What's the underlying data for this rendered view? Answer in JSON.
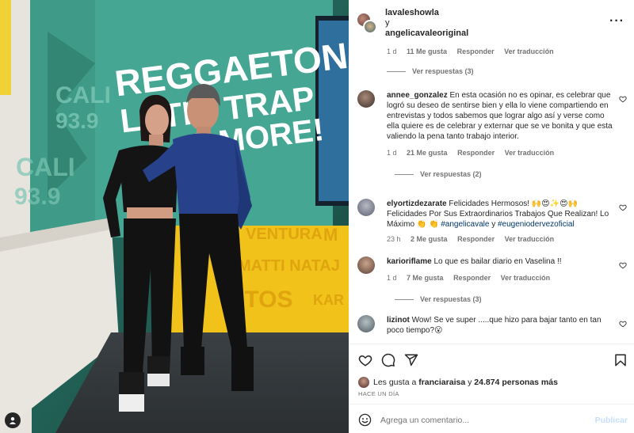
{
  "post": {
    "author": "lavaleshowla",
    "connector": "y",
    "coauthor": "angelicavaleoriginal",
    "more_icon": "more-dots-icon"
  },
  "photo": {
    "sign_main": "REGGAETON,",
    "sign_line2": "LATIN TRAP",
    "sign_line3": "& MORE!",
    "station_a": "CALI",
    "station_b": "93.9",
    "station_c": "CALI",
    "station_d": "93.9",
    "wall_1": "VENTURA",
    "wall_2": "MATTI NATAJ",
    "wall_3": "ITOS",
    "wall_4": "KAR",
    "wall_5": "M"
  },
  "comments": [
    {
      "meta": {
        "time": "1 d",
        "likes": "11 Me gusta",
        "reply": "Responder",
        "translate": "Ver traducción"
      },
      "view_replies": "Ver respuestas (3)"
    },
    {
      "user": "annee_gonzalez",
      "text": "En esta ocasión no es opinar, es celebrar que logró su deseo de sentirse bien y ella lo viene compartiendo en entrevistas y todos sabemos que lograr algo así y verse como ella quiere es de celebrar y externar que se ve bonita y que esta valiendo la pena tanto trabajo interior.",
      "time": "1 d",
      "likes": "21 Me gusta",
      "reply": "Responder",
      "translate": "Ver traducción",
      "view_replies": "Ver respuestas (2)"
    },
    {
      "user": "elyortizdezarate",
      "text_a": "Felicidades Hermosos! 🙌😍✨😍🙌 Felicidades Por Sus Extraordinarios Trabajos Que Realizan! Lo Máximo 👏 👏",
      "tag1": "#angelicavale",
      "text_b": "y",
      "tag2": "#eugeniodervezoficial",
      "time": "23 h",
      "likes": "2 Me gusta",
      "reply": "Responder",
      "translate": "Ver traducción"
    },
    {
      "user": "karioriflame",
      "text": "Lo que es bailar diario en Vaselina !!",
      "time": "1 d",
      "likes": "7 Me gusta",
      "reply": "Responder",
      "translate": "Ver traducción",
      "view_replies": "Ver respuestas (3)"
    },
    {
      "user": "lizinot",
      "text": "Wow! Se ve super .....que hizo para bajar tanto en tan poco tiempo?😮"
    }
  ],
  "actions": {
    "like_icon": "heart-icon",
    "comment_icon": "comment-bubble-icon",
    "share_icon": "paper-plane-icon",
    "save_icon": "bookmark-icon"
  },
  "likes": {
    "prefix": "Les gusta a",
    "user": "franciaraisa",
    "mid": "y",
    "count": "24.874 personas más"
  },
  "date": "HACE UN DÍA",
  "composer": {
    "placeholder": "Agrega un comentario...",
    "publish": "Publicar"
  },
  "colors": {
    "link": "#00376b",
    "muted": "#737373",
    "publish_disabled": "#c5dffd"
  }
}
